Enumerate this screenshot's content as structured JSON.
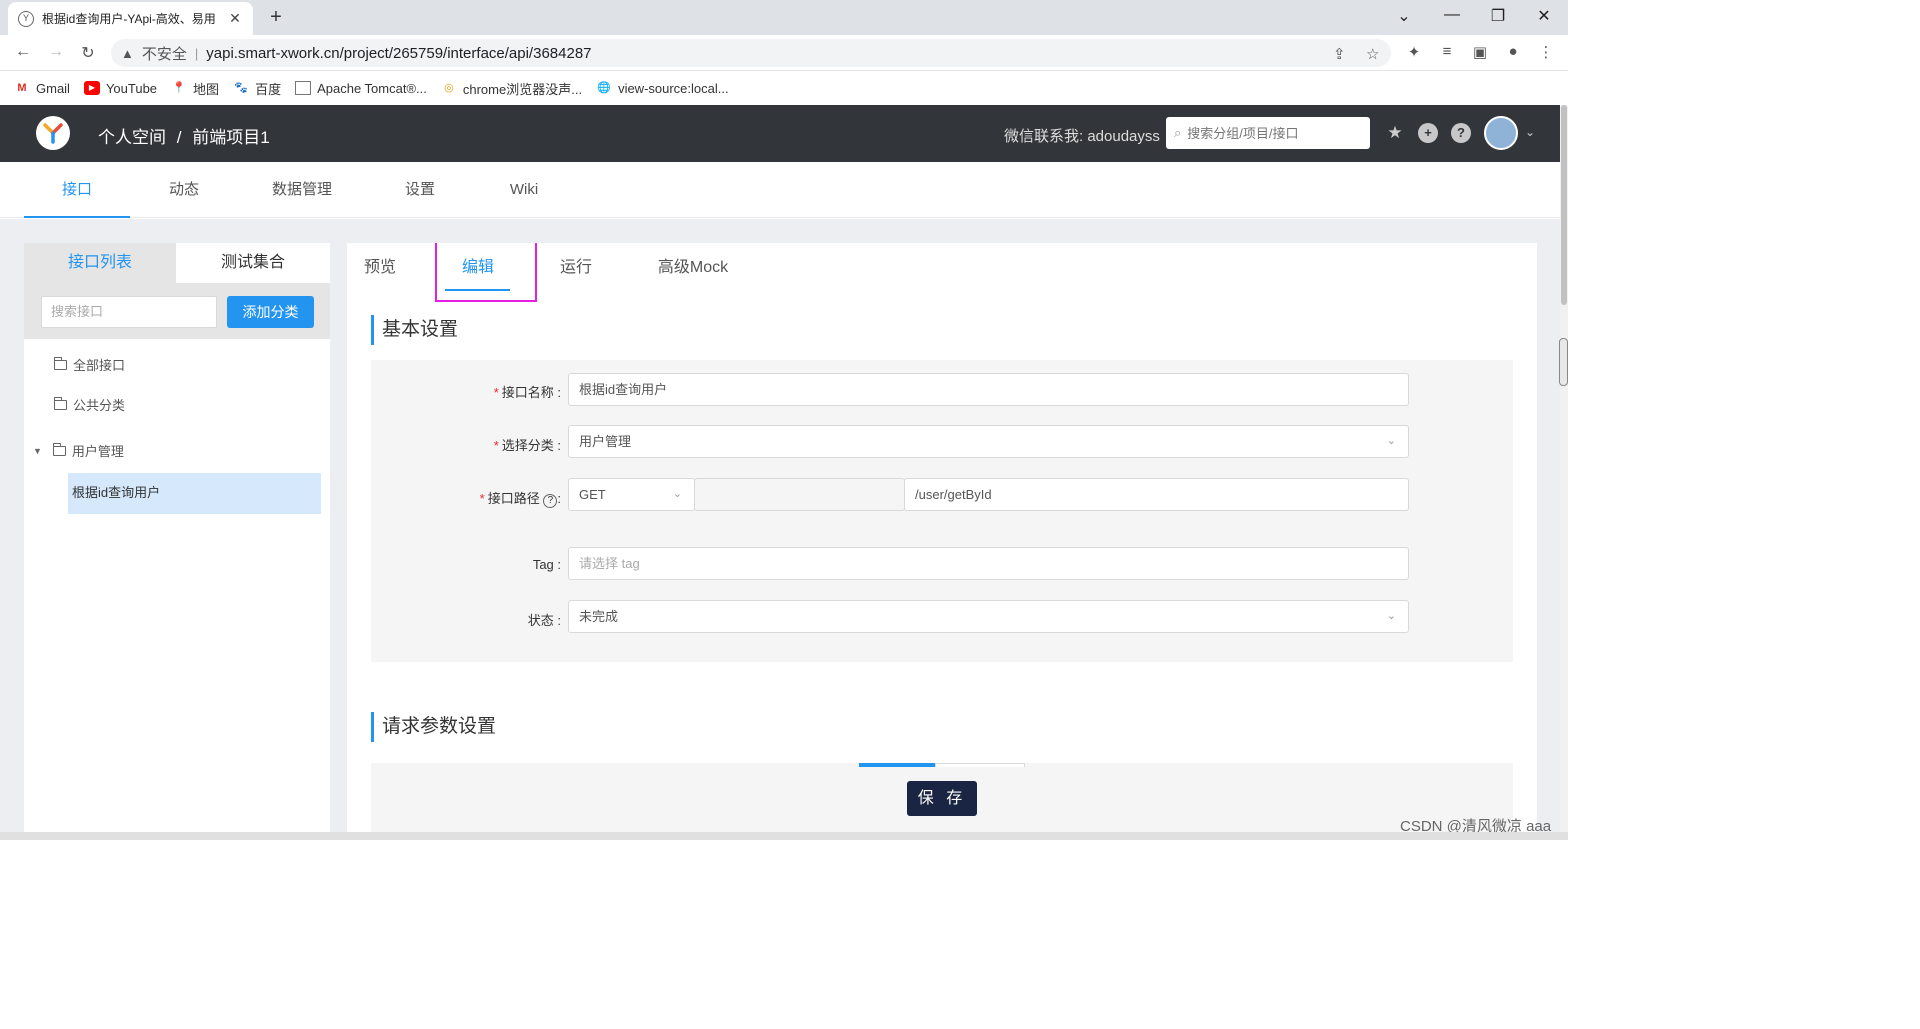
{
  "browser": {
    "tab_title": "根据id查询用户-YApi-高效、易用",
    "new_tab": "+",
    "insecure_label": "不安全",
    "url": "yapi.smart-xwork.cn/project/265759/interface/api/3684287",
    "bookmarks": [
      {
        "label": "Gmail",
        "icon": "gmail-icon"
      },
      {
        "label": "YouTube",
        "icon": "youtube-icon"
      },
      {
        "label": "地图",
        "icon": "maps-icon"
      },
      {
        "label": "百度",
        "icon": "baidu-icon"
      },
      {
        "label": "Apache Tomcat®...",
        "icon": "tomcat-icon"
      },
      {
        "label": "chrome浏览器没声...",
        "icon": "chrome-icon"
      },
      {
        "label": "view-source:local...",
        "icon": "globe-icon"
      }
    ]
  },
  "header": {
    "breadcrumb_space": "个人空间",
    "breadcrumb_sep": "/",
    "breadcrumb_project": "前端项目1",
    "wechat_contact": "微信联系我: adoudayss",
    "search_placeholder": "搜索分组/项目/接口"
  },
  "project_nav": [
    "接口",
    "动态",
    "数据管理",
    "设置",
    "Wiki"
  ],
  "sidebar": {
    "tabs": [
      "接口列表",
      "测试集合"
    ],
    "search_placeholder": "搜索接口",
    "add_category_label": "添加分类",
    "tree": {
      "all": "全部接口",
      "public": "公共分类",
      "user_mgmt": "用户管理",
      "selected_leaf": "根据id查询用户"
    }
  },
  "main": {
    "tabs": [
      "预览",
      "编辑",
      "运行",
      "高级Mock"
    ],
    "active_tab": "编辑",
    "basic_title": "基本设置",
    "form": {
      "name_label": "接口名称 :",
      "name_value": "根据id查询用户",
      "category_label": "选择分类 :",
      "category_value": "用户管理",
      "path_label": "接口路径",
      "path_label_colon": ":",
      "method_value": "GET",
      "path_value": "/user/getById",
      "tag_label": "Tag :",
      "tag_placeholder": "请选择 tag",
      "status_label": "状态 :",
      "status_value": "未完成"
    },
    "request_title": "请求参数设置",
    "save_label": "保 存"
  },
  "watermark": "CSDN @清风微凉 aaa",
  "colors": {
    "accent": "#2395f1",
    "header_bg": "#32363a",
    "highlight": "#e51ee5",
    "save_bg": "#1a2443"
  }
}
